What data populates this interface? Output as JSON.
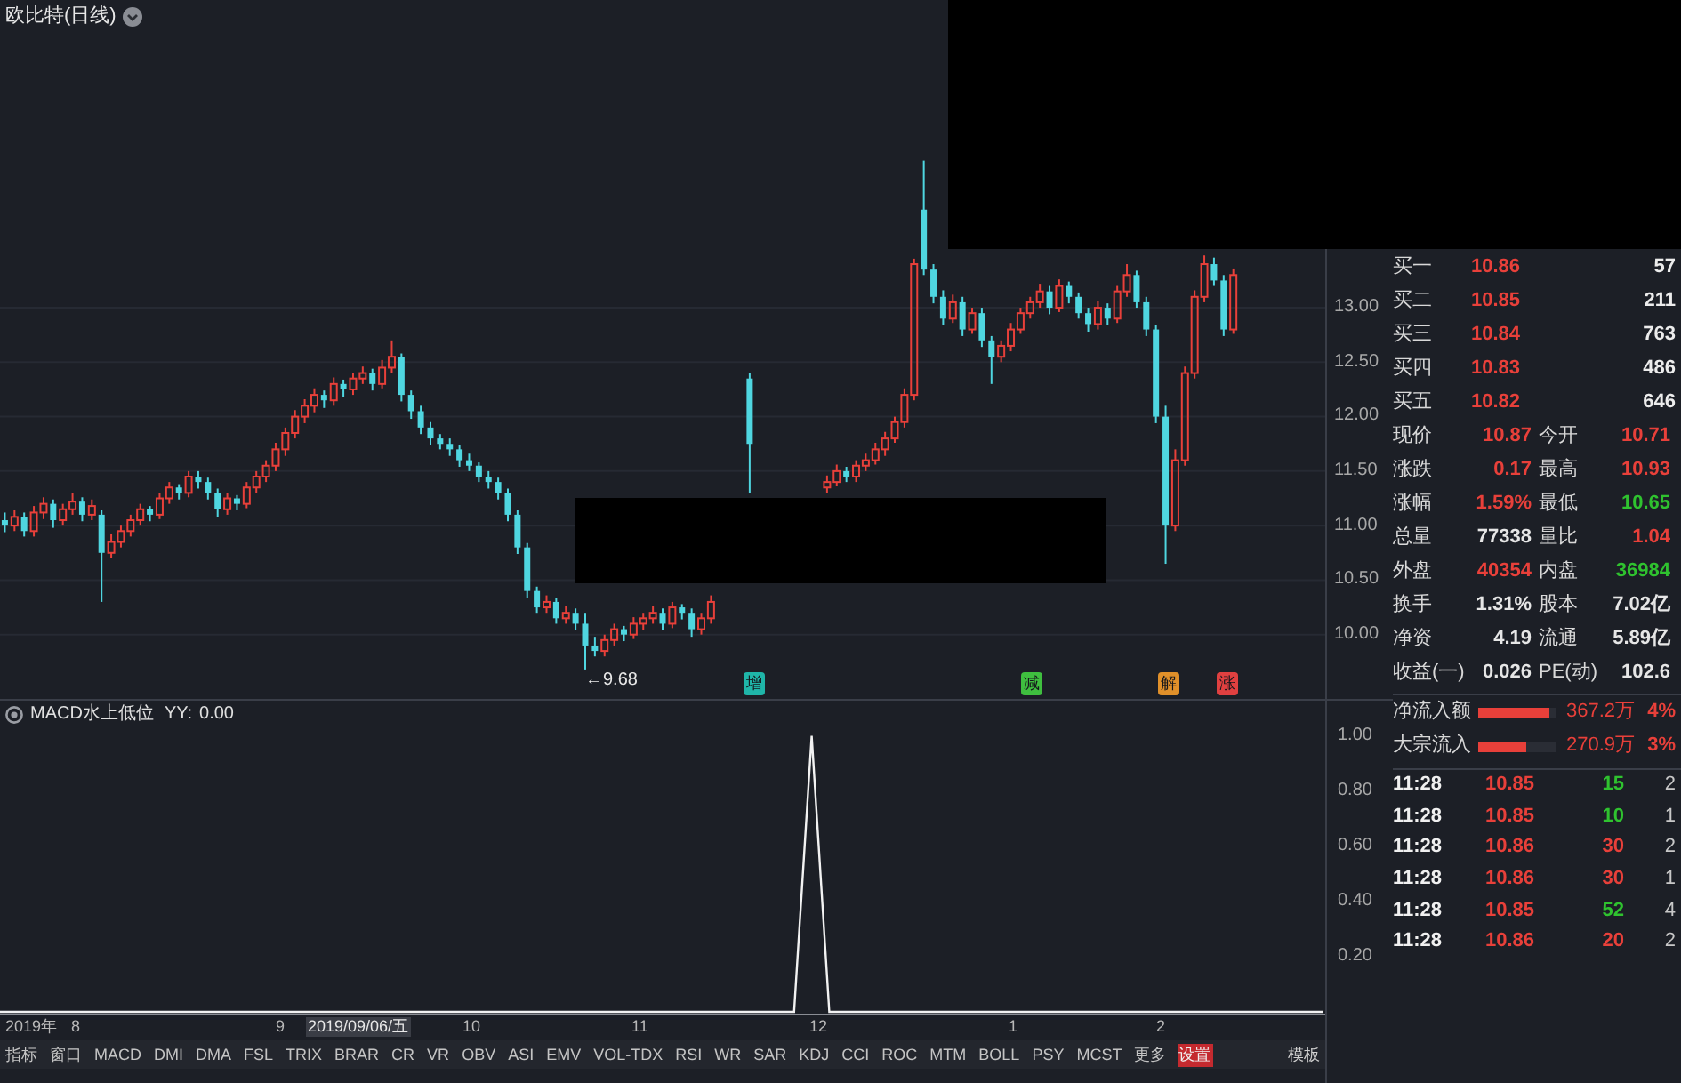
{
  "title_bar": {
    "title": "欧比特(日线)"
  },
  "price_chart": {
    "low_marker": "←9.68",
    "signals": [
      {
        "text": "增",
        "color": "#1fb5a8"
      },
      {
        "text": "减",
        "color": "#3fbf3f"
      },
      {
        "text": "解",
        "color": "#e0902a"
      },
      {
        "text": "涨",
        "color": "#e04040"
      }
    ],
    "chart_data": {
      "type": "candlestick",
      "grid": true,
      "categories": [
        null,
        null,
        null,
        null,
        null,
        null,
        null,
        null,
        null,
        null,
        null,
        null,
        null,
        null,
        null,
        null,
        null,
        null,
        null,
        null,
        null,
        null,
        null,
        null,
        null,
        null,
        null,
        null,
        null,
        null,
        null,
        null,
        null,
        null,
        null,
        null,
        null,
        null,
        null,
        null,
        null,
        null,
        null,
        null,
        null,
        null,
        null,
        null,
        null,
        null,
        null,
        null,
        null,
        null,
        null,
        null,
        null,
        null,
        null,
        null,
        null,
        null,
        null,
        null,
        null,
        null,
        null,
        null,
        null,
        null,
        null,
        null,
        null,
        null,
        null,
        null,
        null,
        null,
        null,
        null,
        null,
        null,
        null,
        null,
        null,
        null,
        null,
        null,
        null,
        null,
        null,
        null,
        null,
        null,
        null,
        null,
        null,
        null,
        null,
        null,
        null,
        null,
        null,
        null,
        null,
        null,
        null,
        null,
        null,
        null,
        null,
        null,
        null,
        null,
        null,
        null,
        null,
        null,
        null,
        null,
        null,
        null,
        null,
        null,
        null,
        null,
        null,
        null,
        null,
        null,
        null,
        null,
        null,
        null,
        null,
        null,
        null
      ],
      "ohlc": [
        [
          11.05,
          11.12,
          10.94,
          11.0
        ],
        [
          11.0,
          11.14,
          10.95,
          11.08
        ],
        [
          11.08,
          11.12,
          10.9,
          10.95
        ],
        [
          10.95,
          11.18,
          10.9,
          11.12
        ],
        [
          11.12,
          11.26,
          11.06,
          11.2
        ],
        [
          11.2,
          11.24,
          10.98,
          11.05
        ],
        [
          11.05,
          11.2,
          11.0,
          11.15
        ],
        [
          11.15,
          11.3,
          11.1,
          11.22
        ],
        [
          11.22,
          11.26,
          11.04,
          11.1
        ],
        [
          11.1,
          11.24,
          11.05,
          11.18
        ],
        [
          11.1,
          11.14,
          10.3,
          10.75
        ],
        [
          10.75,
          10.92,
          10.7,
          10.85
        ],
        [
          10.85,
          11.0,
          10.8,
          10.95
        ],
        [
          10.95,
          11.1,
          10.9,
          11.05
        ],
        [
          11.05,
          11.2,
          11.0,
          11.15
        ],
        [
          11.15,
          11.18,
          11.04,
          11.1
        ],
        [
          11.1,
          11.3,
          11.06,
          11.25
        ],
        [
          11.25,
          11.4,
          11.2,
          11.35
        ],
        [
          11.35,
          11.38,
          11.24,
          11.3
        ],
        [
          11.3,
          11.5,
          11.26,
          11.45
        ],
        [
          11.45,
          11.5,
          11.34,
          11.4
        ],
        [
          11.4,
          11.44,
          11.24,
          11.3
        ],
        [
          11.3,
          11.34,
          11.08,
          11.15
        ],
        [
          11.15,
          11.3,
          11.1,
          11.25
        ],
        [
          11.25,
          11.28,
          11.14,
          11.2
        ],
        [
          11.2,
          11.4,
          11.16,
          11.35
        ],
        [
          11.35,
          11.5,
          11.3,
          11.45
        ],
        [
          11.45,
          11.6,
          11.4,
          11.55
        ],
        [
          11.55,
          11.76,
          11.5,
          11.7
        ],
        [
          11.7,
          11.9,
          11.64,
          11.85
        ],
        [
          11.85,
          12.06,
          11.8,
          12.0
        ],
        [
          12.0,
          12.16,
          11.94,
          12.1
        ],
        [
          12.1,
          12.26,
          12.04,
          12.2
        ],
        [
          12.2,
          12.24,
          12.08,
          12.15
        ],
        [
          12.15,
          12.36,
          12.1,
          12.3
        ],
        [
          12.3,
          12.34,
          12.18,
          12.25
        ],
        [
          12.25,
          12.4,
          12.2,
          12.35
        ],
        [
          12.35,
          12.46,
          12.3,
          12.4
        ],
        [
          12.4,
          12.44,
          12.24,
          12.3
        ],
        [
          12.3,
          12.52,
          12.26,
          12.45
        ],
        [
          12.45,
          12.7,
          12.4,
          12.55
        ],
        [
          12.55,
          12.58,
          12.14,
          12.2
        ],
        [
          12.2,
          12.24,
          11.98,
          12.05
        ],
        [
          12.05,
          12.1,
          11.84,
          11.9
        ],
        [
          11.9,
          11.95,
          11.74,
          11.8
        ],
        [
          11.8,
          11.84,
          11.7,
          11.75
        ],
        [
          11.75,
          11.8,
          11.64,
          11.7
        ],
        [
          11.7,
          11.74,
          11.54,
          11.6
        ],
        [
          11.6,
          11.66,
          11.5,
          11.55
        ],
        [
          11.55,
          11.58,
          11.4,
          11.45
        ],
        [
          11.45,
          11.5,
          11.34,
          11.4
        ],
        [
          11.4,
          11.44,
          11.24,
          11.3
        ],
        [
          11.3,
          11.34,
          11.04,
          11.1
        ],
        [
          11.1,
          11.14,
          10.74,
          10.8
        ],
        [
          10.8,
          10.84,
          10.34,
          10.4
        ],
        [
          10.4,
          10.44,
          10.2,
          10.25
        ],
        [
          10.25,
          10.36,
          10.2,
          10.3
        ],
        [
          10.3,
          10.34,
          10.1,
          10.15
        ],
        [
          10.15,
          10.26,
          10.1,
          10.2
        ],
        [
          10.2,
          10.24,
          10.04,
          10.1
        ],
        [
          10.1,
          10.2,
          9.68,
          9.9
        ],
        [
          9.9,
          9.98,
          9.8,
          9.85
        ],
        [
          9.85,
          10.0,
          9.8,
          9.95
        ],
        [
          9.95,
          10.1,
          9.9,
          10.05
        ],
        [
          10.05,
          10.08,
          9.94,
          10.0
        ],
        [
          10.0,
          10.16,
          9.96,
          10.1
        ],
        [
          10.1,
          10.2,
          10.04,
          10.15
        ],
        [
          10.15,
          10.26,
          10.1,
          10.2
        ],
        [
          10.2,
          10.24,
          10.04,
          10.1
        ],
        [
          10.1,
          10.3,
          10.06,
          10.25
        ],
        [
          10.25,
          10.28,
          10.14,
          10.2
        ],
        [
          10.2,
          10.24,
          9.98,
          10.05
        ],
        [
          10.05,
          10.2,
          10.0,
          10.15
        ],
        [
          10.15,
          10.36,
          10.1,
          10.3
        ],
        null,
        null,
        null,
        [
          12.35,
          12.4,
          11.3,
          11.75
        ],
        null,
        null,
        null,
        null,
        null,
        null,
        null,
        [
          11.35,
          11.46,
          11.3,
          11.4
        ],
        [
          11.4,
          11.56,
          11.36,
          11.5
        ],
        [
          11.5,
          11.54,
          11.4,
          11.45
        ],
        [
          11.45,
          11.6,
          11.4,
          11.55
        ],
        [
          11.55,
          11.66,
          11.5,
          11.6
        ],
        [
          11.6,
          11.76,
          11.56,
          11.7
        ],
        [
          11.7,
          11.86,
          11.64,
          11.8
        ],
        [
          11.8,
          12.0,
          11.76,
          11.95
        ],
        [
          11.95,
          12.26,
          11.9,
          12.2
        ],
        [
          12.2,
          13.45,
          12.15,
          13.4
        ],
        [
          13.9,
          14.35,
          13.3,
          13.35
        ],
        [
          13.35,
          13.4,
          13.04,
          13.1
        ],
        [
          13.1,
          13.16,
          12.84,
          12.9
        ],
        [
          12.9,
          13.12,
          12.86,
          13.05
        ],
        [
          13.05,
          13.1,
          12.74,
          12.8
        ],
        [
          12.8,
          13.0,
          12.76,
          12.95
        ],
        [
          12.95,
          13.0,
          12.64,
          12.7
        ],
        [
          12.7,
          12.74,
          12.3,
          12.55
        ],
        [
          12.55,
          12.7,
          12.5,
          12.65
        ],
        [
          12.65,
          12.86,
          12.6,
          12.8
        ],
        [
          12.8,
          13.0,
          12.76,
          12.95
        ],
        [
          12.95,
          13.1,
          12.9,
          13.05
        ],
        [
          13.05,
          13.22,
          13.0,
          13.15
        ],
        [
          13.15,
          13.2,
          12.94,
          13.0
        ],
        [
          13.0,
          13.26,
          12.96,
          13.2
        ],
        [
          13.2,
          13.24,
          13.04,
          13.1
        ],
        [
          13.1,
          13.14,
          12.9,
          12.95
        ],
        [
          12.95,
          13.0,
          12.78,
          12.85
        ],
        [
          12.85,
          13.06,
          12.8,
          13.0
        ],
        [
          13.0,
          13.04,
          12.84,
          12.9
        ],
        [
          12.9,
          13.2,
          12.86,
          13.15
        ],
        [
          13.15,
          13.4,
          13.1,
          13.3
        ],
        [
          13.3,
          13.34,
          13.0,
          13.05
        ],
        [
          13.05,
          13.1,
          12.74,
          12.8
        ],
        [
          12.8,
          12.84,
          11.94,
          12.0
        ],
        [
          12.0,
          12.1,
          10.65,
          11.0
        ],
        [
          11.0,
          11.7,
          10.95,
          11.6
        ],
        [
          11.6,
          12.46,
          11.55,
          12.4
        ],
        [
          12.4,
          13.16,
          12.35,
          13.1
        ],
        [
          13.1,
          13.48,
          13.05,
          13.4
        ],
        [
          13.4,
          13.46,
          13.2,
          13.25
        ],
        [
          13.25,
          13.3,
          12.74,
          12.8
        ],
        [
          12.8,
          13.36,
          12.76,
          13.3
        ],
        null,
        null,
        null,
        null,
        null,
        null,
        null,
        null,
        null
      ],
      "ylim": [
        9.41,
        15.53
      ],
      "yticks": [
        {
          "value": 13,
          "label": "13.00"
        },
        {
          "value": 12.5,
          "label": "12.50"
        },
        {
          "value": 12,
          "label": "12.00"
        },
        {
          "value": 11.5,
          "label": "11.50"
        },
        {
          "value": 11,
          "label": "11.00"
        },
        {
          "value": 10.5,
          "label": "10.50"
        },
        {
          "value": 10,
          "label": "10.00"
        }
      ]
    }
  },
  "indicator_panel": {
    "reading": "0.00",
    "chart_data": {
      "type": "line",
      "title": "MACD水上低位",
      "categories": [
        null,
        null,
        null,
        null,
        null,
        null,
        null,
        null,
        null,
        null,
        null,
        null,
        null,
        null,
        null,
        null,
        null,
        null,
        null,
        null,
        null,
        null,
        null,
        null,
        null,
        null,
        null,
        null,
        null,
        null,
        null,
        null,
        null,
        null,
        null,
        null,
        null,
        null,
        null,
        null,
        null,
        null,
        null,
        null,
        null,
        null,
        null,
        null,
        null,
        null,
        null,
        null,
        null,
        null,
        null,
        null,
        null,
        null,
        null,
        null,
        null,
        null,
        null,
        null,
        null,
        null,
        null,
        null,
        null,
        null,
        null,
        null,
        null,
        null,
        null,
        null
      ],
      "series": [
        {
          "name": "YY:",
          "color": "#f2f2f2",
          "values": [
            0,
            0,
            0,
            0,
            0,
            0,
            0,
            0,
            0,
            0,
            0,
            0,
            0,
            0,
            0,
            0,
            0,
            0,
            0,
            0,
            0,
            0,
            0,
            0,
            0,
            0,
            0,
            0,
            0,
            0,
            0,
            0,
            0,
            0,
            0,
            0,
            0,
            0,
            0,
            0,
            0,
            0,
            0,
            0,
            0,
            0,
            1,
            0,
            0,
            0,
            0,
            0,
            0,
            0,
            0,
            0,
            0,
            0,
            0,
            0,
            0,
            0,
            0,
            0,
            0,
            0,
            0,
            0,
            0,
            0,
            0,
            0,
            0,
            0,
            0,
            0
          ]
        }
      ],
      "ylim": [
        0,
        1.05
      ],
      "yticks": [
        {
          "value": 1,
          "label": "1.00"
        },
        {
          "value": 0.8,
          "label": "0.80"
        },
        {
          "value": 0.6,
          "label": "0.60"
        },
        {
          "value": 0.4,
          "label": "0.40"
        },
        {
          "value": 0.2,
          "label": "0.20"
        }
      ]
    }
  },
  "date_axis": {
    "labels": [
      "2019年",
      "8",
      "9",
      "10",
      "11",
      "12",
      "1",
      "2"
    ],
    "cursor_date": "2019/09/06/五"
  },
  "bottom_tabs": [
    {
      "label": "指标",
      "selected": false
    },
    {
      "label": "窗口",
      "selected": false
    },
    {
      "label": "MACD",
      "selected": false
    },
    {
      "label": "DMI",
      "selected": false
    },
    {
      "label": "DMA",
      "selected": false
    },
    {
      "label": "FSL",
      "selected": false
    },
    {
      "label": "TRIX",
      "selected": false
    },
    {
      "label": "BRAR",
      "selected": false
    },
    {
      "label": "CR",
      "selected": false
    },
    {
      "label": "VR",
      "selected": false
    },
    {
      "label": "OBV",
      "selected": false
    },
    {
      "label": "ASI",
      "selected": false
    },
    {
      "label": "EMV",
      "selected": false
    },
    {
      "label": "VOL-TDX",
      "selected": false
    },
    {
      "label": "RSI",
      "selected": false
    },
    {
      "label": "WR",
      "selected": false
    },
    {
      "label": "SAR",
      "selected": false
    },
    {
      "label": "KDJ",
      "selected": false
    },
    {
      "label": "CCI",
      "selected": false
    },
    {
      "label": "ROC",
      "selected": false
    },
    {
      "label": "MTM",
      "selected": false
    },
    {
      "label": "BOLL",
      "selected": false
    },
    {
      "label": "PSY",
      "selected": false
    },
    {
      "label": "MCST",
      "selected": false
    },
    {
      "label": "更多",
      "selected": false
    },
    {
      "label": "设置",
      "selected": true
    }
  ],
  "template_button": "模板",
  "order_book": [
    {
      "label": "买一",
      "price": "10.86",
      "volume": "57"
    },
    {
      "label": "买二",
      "price": "10.85",
      "volume": "211"
    },
    {
      "label": "买三",
      "price": "10.84",
      "volume": "763"
    },
    {
      "label": "买四",
      "price": "10.83",
      "volume": "486"
    },
    {
      "label": "买五",
      "price": "10.82",
      "volume": "646"
    }
  ],
  "quote_rows": [
    [
      {
        "label": "现价",
        "value": "10.87",
        "color": "#e8403a"
      },
      {
        "label": "今开",
        "value": "10.71",
        "color": "#e8403a"
      }
    ],
    [
      {
        "label": "涨跌",
        "value": "0.17",
        "color": "#e8403a"
      },
      {
        "label": "最高",
        "value": "10.93",
        "color": "#e8403a"
      }
    ],
    [
      {
        "label": "涨幅",
        "value": "1.59%",
        "color": "#e8403a"
      },
      {
        "label": "最低",
        "value": "10.65",
        "color": "#2fc22f"
      }
    ],
    [
      {
        "label": "总量",
        "value": "77338",
        "color": "#e6e6e6"
      },
      {
        "label": "量比",
        "value": "1.04",
        "color": "#e8403a"
      }
    ],
    [
      {
        "label": "外盘",
        "value": "40354",
        "color": "#e8403a"
      },
      {
        "label": "内盘",
        "value": "36984",
        "color": "#2fc22f"
      }
    ],
    [
      {
        "label": "换手",
        "value": "1.31%",
        "color": "#e6e6e6"
      },
      {
        "label": "股本",
        "value": "7.02亿",
        "color": "#e6e6e6"
      }
    ],
    [
      {
        "label": "净资",
        "value": "4.19",
        "color": "#e6e6e6"
      },
      {
        "label": "流通",
        "value": "5.89亿",
        "color": "#e6e6e6"
      }
    ],
    [
      {
        "label": "收益(一)",
        "value": "0.026",
        "color": "#e6e6e6"
      },
      {
        "label": "PE(动)",
        "value": "102.6",
        "color": "#e6e6e6"
      }
    ]
  ],
  "fund_flow": [
    {
      "label": "净流入额",
      "level": 0.9,
      "amount": "367.2万",
      "percent": "4%"
    },
    {
      "label": "大宗流入",
      "level": 0.62,
      "amount": "270.9万",
      "percent": "3%"
    }
  ],
  "trades": [
    {
      "time": "11:28",
      "price": "10.85",
      "volume": "15",
      "color": "#2fc22f",
      "count": "2"
    },
    {
      "time": "11:28",
      "price": "10.85",
      "volume": "10",
      "color": "#2fc22f",
      "count": "1"
    },
    {
      "time": "11:28",
      "price": "10.86",
      "volume": "30",
      "color": "#e8403a",
      "count": "2"
    },
    {
      "time": "11:28",
      "price": "10.86",
      "volume": "30",
      "color": "#e8403a",
      "count": "1"
    },
    {
      "time": "11:28",
      "price": "10.85",
      "volume": "52",
      "color": "#2fc22f",
      "count": "4"
    },
    {
      "time": "11:28",
      "price": "10.86",
      "volume": "20",
      "color": "#e8403a",
      "count": "2"
    }
  ]
}
